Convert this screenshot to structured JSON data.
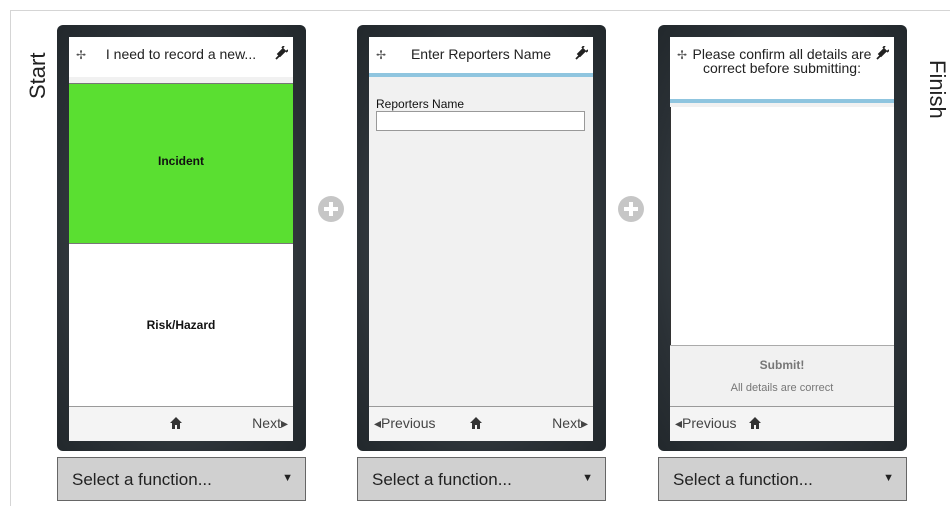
{
  "side_labels": {
    "start": "Start",
    "finish": "Finish"
  },
  "screens": [
    {
      "title": "I need to record a new...",
      "options": [
        "Incident",
        "Risk/Hazard"
      ],
      "footer": {
        "next": "Next",
        "next_arrow": "▸"
      }
    },
    {
      "title": "Enter Reporters Name",
      "field_label": "Reporters Name",
      "field_value": "",
      "footer": {
        "prev": "Previous",
        "prev_arrow": "◂",
        "next": "Next",
        "next_arrow": "▸"
      }
    },
    {
      "title": "Please confirm all details are correct before submitting:",
      "submit_title": "Submit!",
      "submit_sub": "All details are correct",
      "footer": {
        "prev": "Previous",
        "prev_arrow": "◂"
      }
    }
  ],
  "select": {
    "label": "Select a function...",
    "arrow": "▼"
  },
  "colors": {
    "accent_green": "#5adf31",
    "title_underline": "#8fc5df",
    "frame": "#2a3035"
  },
  "icons": [
    "pin-icon",
    "plug-icon",
    "home-icon",
    "add-step-icon"
  ]
}
